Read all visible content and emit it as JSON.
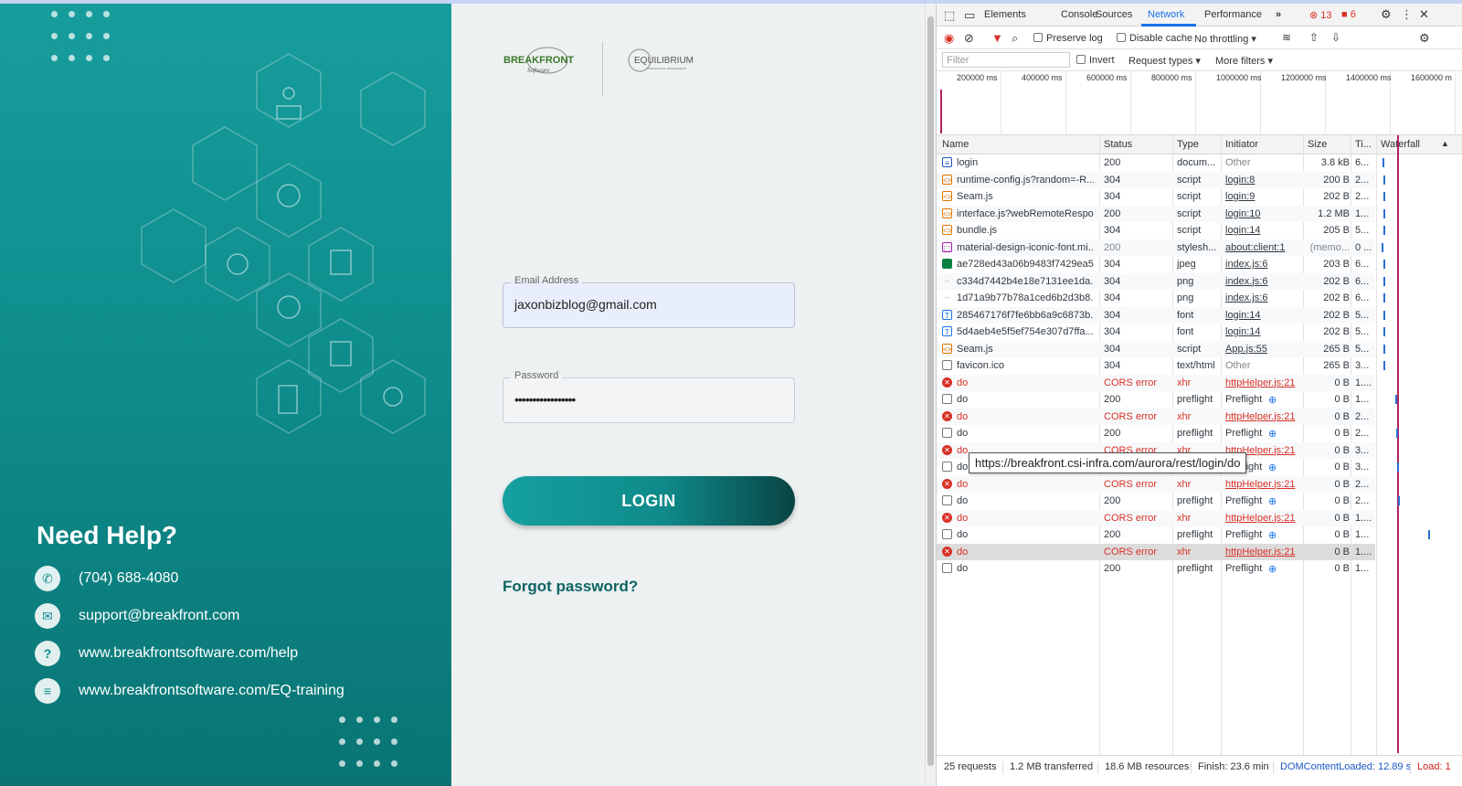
{
  "login_page": {
    "help": {
      "title": "Need Help?",
      "phone": "(704) 688-4080",
      "email": "support@breakfront.com",
      "help_url": "www.breakfrontsoftware.com/help",
      "training_url": "www.breakfrontsoftware.com/EQ-training"
    },
    "logos": {
      "breakfront": "BREAKFRONT",
      "breakfront_sub": "Software",
      "equilibrium": "EQUILIBRIUM",
      "equilibrium_sub": "OPERATIONAL MANAGEMENT"
    },
    "email_field": {
      "label": "Email Address",
      "value": "jaxonbizblog@gmail.com"
    },
    "password_field": {
      "label": "Password",
      "value": "•••••••••••••••••"
    },
    "login_button": "LOGIN",
    "forgot_link": "Forgot password?"
  },
  "devtools": {
    "tabs": [
      "Elements",
      "Console",
      "Sources",
      "Network",
      "Performance"
    ],
    "active_tab": "Network",
    "more_tabs": "»",
    "error_count": "13",
    "warning_count": "6",
    "toolbar": {
      "preserve_log": "Preserve log",
      "disable_cache": "Disable cache",
      "throttling": "No throttling"
    },
    "filterbar": {
      "placeholder": "Filter",
      "invert": "Invert",
      "request_types": "Request types",
      "more_filters": "More filters"
    },
    "overview_ticks": [
      "200000 ms",
      "400000 ms",
      "600000 ms",
      "800000 ms",
      "1000000 ms",
      "1200000 ms",
      "1400000 ms",
      "1600000 m"
    ],
    "columns": {
      "name": "Name",
      "status": "Status",
      "type": "Type",
      "initiator": "Initiator",
      "size": "Size",
      "time": "Ti...",
      "waterfall": "Waterfall"
    },
    "rows": [
      {
        "name": "login",
        "status": "200",
        "type": "docum...",
        "initiator": "Other",
        "size": "3.8 kB",
        "time": "6...",
        "kind": "doc"
      },
      {
        "name": "runtime-config.js?random=-R...",
        "status": "304",
        "type": "script",
        "initiator": "login:8",
        "size": "200 B",
        "time": "2...",
        "kind": "script"
      },
      {
        "name": "Seam.js",
        "status": "304",
        "type": "script",
        "initiator": "login:9",
        "size": "202 B",
        "time": "2...",
        "kind": "script"
      },
      {
        "name": "interface.js?webRemoteRespo...",
        "status": "200",
        "type": "script",
        "initiator": "login:10",
        "size": "1.2 MB",
        "time": "1...",
        "kind": "script"
      },
      {
        "name": "bundle.js",
        "status": "304",
        "type": "script",
        "initiator": "login:14",
        "size": "205 B",
        "time": "5...",
        "kind": "script"
      },
      {
        "name": "material-design-iconic-font.mi...",
        "status": "200",
        "type": "stylesh...",
        "initiator": "about:client:1",
        "size": "(memo...",
        "time": "0 ...",
        "kind": "style"
      },
      {
        "name": "ae728ed43a06b9483f7429ea5...",
        "status": "304",
        "type": "jpeg",
        "initiator": "index.js:6",
        "size": "203 B",
        "time": "6...",
        "kind": "img"
      },
      {
        "name": "c334d7442b4e18e7131ee1da...",
        "status": "304",
        "type": "png",
        "initiator": "index.js:6",
        "size": "202 B",
        "time": "6...",
        "kind": "png"
      },
      {
        "name": "1d71a9b77b78a1ced6b2d3b8...",
        "status": "304",
        "type": "png",
        "initiator": "index.js:6",
        "size": "202 B",
        "time": "6...",
        "kind": "png"
      },
      {
        "name": "285467176f7fe6bb6a9c6873b...",
        "status": "304",
        "type": "font",
        "initiator": "login:14",
        "size": "202 B",
        "time": "5...",
        "kind": "font"
      },
      {
        "name": "5d4aeb4e5f5ef754e307d7ffa...",
        "status": "304",
        "type": "font",
        "initiator": "login:14",
        "size": "202 B",
        "time": "5...",
        "kind": "font"
      },
      {
        "name": "Seam.js",
        "status": "304",
        "type": "script",
        "initiator": "App.js:55",
        "size": "265 B",
        "time": "5...",
        "kind": "script"
      },
      {
        "name": "favicon.ico",
        "status": "304",
        "type": "text/html",
        "initiator": "Other",
        "size": "265 B",
        "time": "3...",
        "kind": "blank"
      },
      {
        "name": "do",
        "status": "CORS error",
        "type": "xhr",
        "initiator": "httpHelper.js:21",
        "size": "0 B",
        "time": "1....",
        "kind": "error"
      },
      {
        "name": "do",
        "status": "200",
        "type": "preflight",
        "initiator": "Preflight",
        "size": "0 B",
        "time": "1...",
        "kind": "blank"
      },
      {
        "name": "do",
        "status": "CORS error",
        "type": "xhr",
        "initiator": "httpHelper.js:21",
        "size": "0 B",
        "time": "2...",
        "kind": "error"
      },
      {
        "name": "do",
        "status": "200",
        "type": "preflight",
        "initiator": "Preflight",
        "size": "0 B",
        "time": "2...",
        "kind": "blank"
      },
      {
        "name": "do",
        "status": "CORS error",
        "type": "xhr",
        "initiator": "httpHelper.js:21",
        "size": "0 B",
        "time": "3...",
        "kind": "error"
      },
      {
        "name": "do",
        "status": "200",
        "type": "preflight",
        "initiator": "Preflight",
        "size": "0 B",
        "time": "3...",
        "kind": "blank"
      },
      {
        "name": "do",
        "status": "CORS error",
        "type": "xhr",
        "initiator": "httpHelper.js:21",
        "size": "0 B",
        "time": "2...",
        "kind": "error"
      },
      {
        "name": "do",
        "status": "200",
        "type": "preflight",
        "initiator": "Preflight",
        "size": "0 B",
        "time": "2...",
        "kind": "blank"
      },
      {
        "name": "do",
        "status": "CORS error",
        "type": "xhr",
        "initiator": "httpHelper.js:21",
        "size": "0 B",
        "time": "1....",
        "kind": "error"
      },
      {
        "name": "do",
        "status": "200",
        "type": "preflight",
        "initiator": "Preflight",
        "size": "0 B",
        "time": "1...",
        "kind": "blank"
      },
      {
        "name": "do",
        "status": "CORS error",
        "type": "xhr",
        "initiator": "httpHelper.js:21",
        "size": "0 B",
        "time": "1....",
        "kind": "error"
      },
      {
        "name": "do",
        "status": "200",
        "type": "preflight",
        "initiator": "Preflight",
        "size": "0 B",
        "time": "1...",
        "kind": "blank"
      }
    ],
    "tooltip": "https://breakfront.csi-infra.com/aurora/rest/login/do",
    "statusbar": {
      "requests": "25 requests",
      "transferred": "1.2 MB transferred",
      "resources": "18.6 MB resources",
      "finish": "Finish: 23.6 min",
      "dcl": "DOMContentLoaded: 12.89 s",
      "load": "Load: 1"
    }
  }
}
